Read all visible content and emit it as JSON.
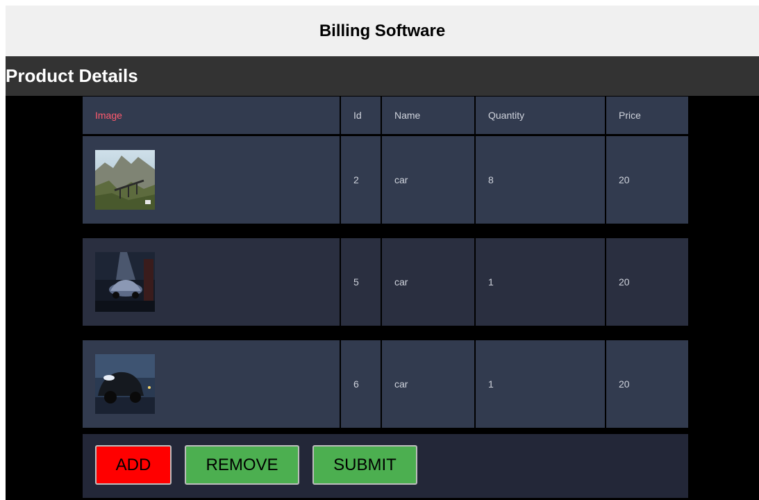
{
  "app": {
    "title": "Billing Software"
  },
  "section": {
    "title": "Product Details"
  },
  "table": {
    "headers": {
      "image": "Image",
      "id": "Id",
      "name": "Name",
      "quantity": "Quantity",
      "price": "Price"
    },
    "rows": [
      {
        "image": "mountain-bridge-thumbnail",
        "id": "2",
        "name": "car",
        "quantity": "8",
        "price": "20"
      },
      {
        "image": "night-car-thumbnail",
        "id": "5",
        "name": "car",
        "quantity": "1",
        "price": "20"
      },
      {
        "image": "race-car-thumbnail",
        "id": "6",
        "name": "car",
        "quantity": "1",
        "price": "20"
      }
    ]
  },
  "buttons": {
    "add": "ADD",
    "remove": "REMOVE",
    "submit": "SUBMIT"
  },
  "colors": {
    "header_bg": "#f0f0f0",
    "section_bg": "#333333",
    "row_bg": "#323b4f",
    "row_alt_bg": "#2a2f40",
    "image_header_text": "#ff5a6e",
    "add_button": "#ff0000",
    "remove_button": "#4caf50",
    "submit_button": "#4caf50"
  }
}
